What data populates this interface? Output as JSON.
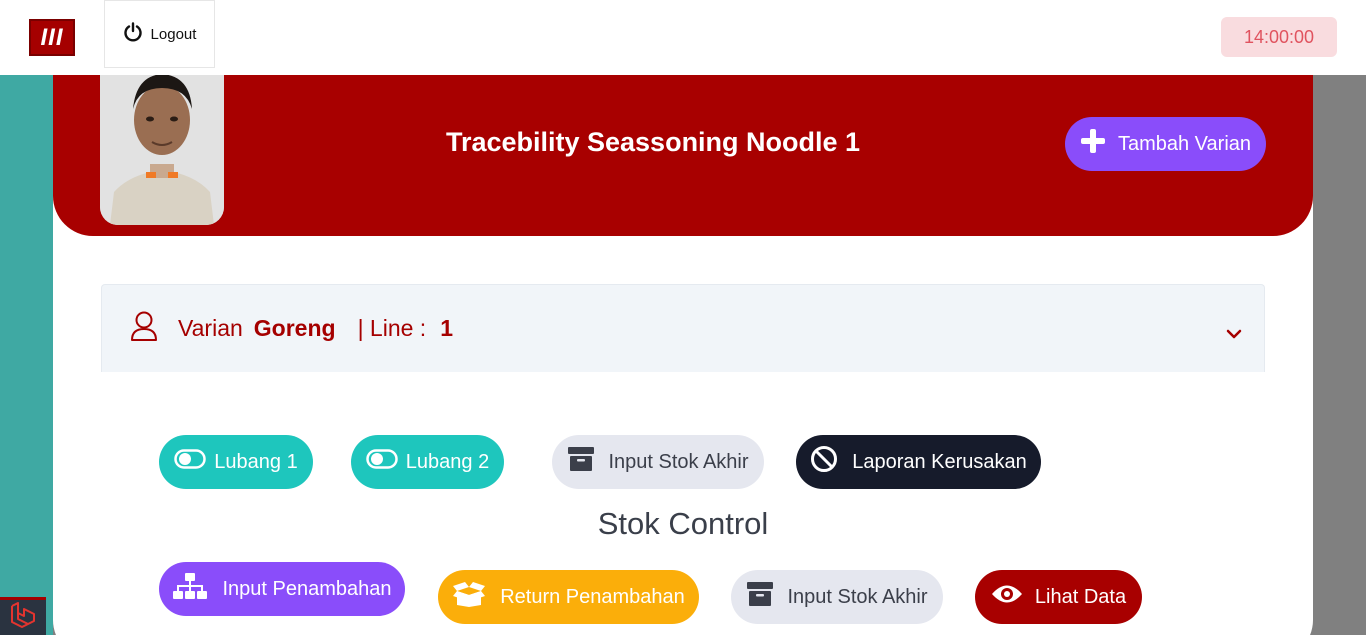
{
  "topbar": {
    "logo_text": "III",
    "logout_label": "Logout",
    "clock": "14:00:00"
  },
  "banner": {
    "title": "Tracebility Seassoning Noodle 1",
    "add_button_label": "Tambah Varian"
  },
  "accordion": {
    "label": "Varian",
    "value": "Goreng",
    "line_label": "| Line :",
    "line_value": "1"
  },
  "row1": {
    "lubang1": "Lubang 1",
    "lubang2": "Lubang 2",
    "input_stok_akhir": "Input Stok Akhir",
    "laporan_kerusakan": "Laporan Kerusakan"
  },
  "section_title": "Stok Control",
  "row2": {
    "input_penambahan": "Input Penambahan",
    "return_penambahan": "Return Penambahan",
    "input_stok_akhir": "Input Stok Akhir",
    "lihat_data": "Lihat Data"
  },
  "colors": {
    "brand_red": "#a80000",
    "teal": "#1ec6bd",
    "purple": "#8a4dfa",
    "amber": "#fbae0a",
    "dark": "#161b2b"
  }
}
